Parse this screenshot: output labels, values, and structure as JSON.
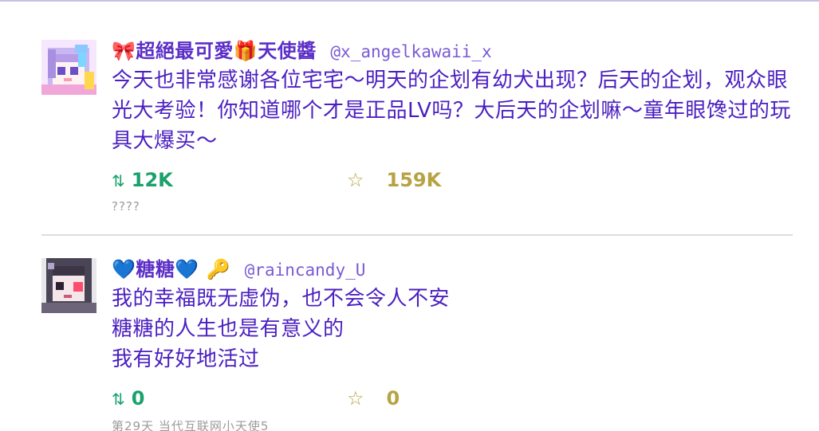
{
  "posts": [
    {
      "display_name": "🎀超絕最可愛🎁天使醬",
      "handle": "@x_angelkawaii_x",
      "text": "今天也非常感谢各位宅宅～明天的企划有幼犬出现？后天的企划，观众眼光大考验！你知道哪个才是正品LV吗？大后天的企划嘛～童年眼馋过的玩具大爆买～",
      "retweet_icon": "retweet-icon",
      "retweets": "12K",
      "favorite_icon": "star-icon",
      "favorites": "159K",
      "meta": "????",
      "avatar": "angel-avatar"
    },
    {
      "display_name": "💙糖糖💙 🔑",
      "handle": "@raincandy_U",
      "text_lines": [
        "我的幸福既无虚伪，也不会令人不安",
        "糖糖的人生也是有意义的",
        "我有好好地活过"
      ],
      "retweet_icon": "retweet-icon",
      "retweets": "0",
      "favorite_icon": "star-icon",
      "favorites": "0",
      "meta": "第29天 当代互联网小天使5",
      "avatar": "ame-avatar"
    }
  ],
  "colors": {
    "text": "#4b1fc0",
    "name": "#5b2fc7",
    "retweet": "#1aa16c",
    "favorite": "#b7a343",
    "meta": "#9a9a9a",
    "divider": "#dcdcdc",
    "frame_border": "#c9bfe6"
  }
}
